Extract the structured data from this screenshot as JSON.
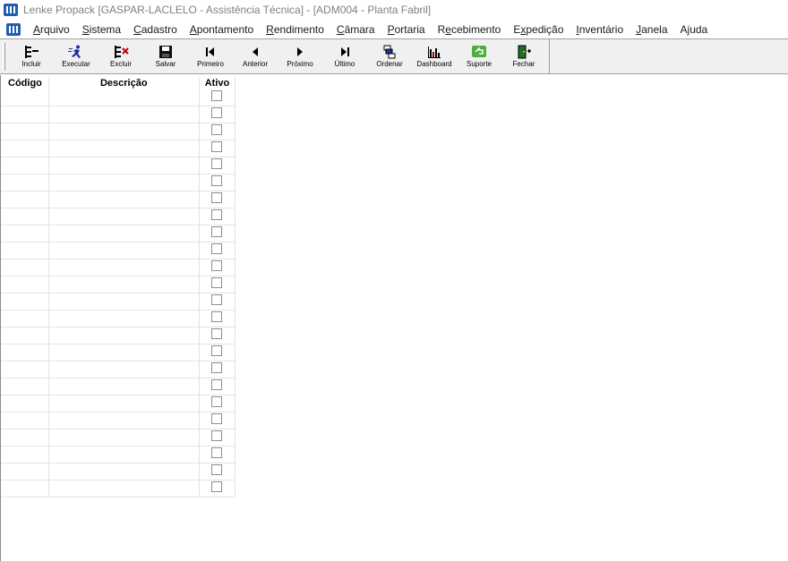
{
  "window": {
    "title": "Lenke Propack [GASPAR-LACLELO - Assistência Técnica] - [ADM004 - Planta Fabril]",
    "app_icon": "app-logo-icon"
  },
  "menu": {
    "items": [
      {
        "label": "Arquivo",
        "accel": "A"
      },
      {
        "label": "Sistema",
        "accel": "S"
      },
      {
        "label": "Cadastro",
        "accel": "C"
      },
      {
        "label": "Apontamento",
        "accel": "A"
      },
      {
        "label": "Rendimento",
        "accel": "R"
      },
      {
        "label": "Câmara",
        "accel": "C"
      },
      {
        "label": "Portaria",
        "accel": "P"
      },
      {
        "label": "Recebimento",
        "accel": "e"
      },
      {
        "label": "Expedição",
        "accel": "x"
      },
      {
        "label": "Inventário",
        "accel": "I"
      },
      {
        "label": "Janela",
        "accel": "J"
      },
      {
        "label": "Ajuda",
        "accel": "j"
      }
    ]
  },
  "toolbar": {
    "buttons": [
      {
        "label": "Incluir",
        "icon": "add-record-icon"
      },
      {
        "label": "Executar",
        "icon": "run-icon"
      },
      {
        "label": "Excluir",
        "icon": "delete-record-icon"
      },
      {
        "label": "Salvar",
        "icon": "save-icon"
      },
      {
        "label": "Primeiro",
        "icon": "first-icon"
      },
      {
        "label": "Anterior",
        "icon": "previous-icon"
      },
      {
        "label": "Próximo",
        "icon": "next-icon"
      },
      {
        "label": "Último",
        "icon": "last-icon"
      },
      {
        "label": "Ordenar",
        "icon": "sort-icon"
      },
      {
        "label": "Dashboard",
        "icon": "dashboard-icon"
      },
      {
        "label": "Suporte",
        "icon": "support-icon"
      },
      {
        "label": "Fechar",
        "icon": "close-door-icon"
      }
    ]
  },
  "grid": {
    "columns": [
      "Código",
      "Descrição",
      "Ativo"
    ],
    "rows": [
      {
        "codigo": "",
        "descricao": "",
        "ativo": false
      },
      {
        "codigo": "",
        "descricao": "",
        "ativo": false
      },
      {
        "codigo": "",
        "descricao": "",
        "ativo": false
      },
      {
        "codigo": "",
        "descricao": "",
        "ativo": false
      },
      {
        "codigo": "",
        "descricao": "",
        "ativo": false
      },
      {
        "codigo": "",
        "descricao": "",
        "ativo": false
      },
      {
        "codigo": "",
        "descricao": "",
        "ativo": false
      },
      {
        "codigo": "",
        "descricao": "",
        "ativo": false
      },
      {
        "codigo": "",
        "descricao": "",
        "ativo": false
      },
      {
        "codigo": "",
        "descricao": "",
        "ativo": false
      },
      {
        "codigo": "",
        "descricao": "",
        "ativo": false
      },
      {
        "codigo": "",
        "descricao": "",
        "ativo": false
      },
      {
        "codigo": "",
        "descricao": "",
        "ativo": false
      },
      {
        "codigo": "",
        "descricao": "",
        "ativo": false
      },
      {
        "codigo": "",
        "descricao": "",
        "ativo": false
      },
      {
        "codigo": "",
        "descricao": "",
        "ativo": false
      },
      {
        "codigo": "",
        "descricao": "",
        "ativo": false
      },
      {
        "codigo": "",
        "descricao": "",
        "ativo": false
      },
      {
        "codigo": "",
        "descricao": "",
        "ativo": false
      },
      {
        "codigo": "",
        "descricao": "",
        "ativo": false
      },
      {
        "codigo": "",
        "descricao": "",
        "ativo": false
      },
      {
        "codigo": "",
        "descricao": "",
        "ativo": false
      },
      {
        "codigo": "",
        "descricao": "",
        "ativo": false
      },
      {
        "codigo": "",
        "descricao": "",
        "ativo": false
      }
    ]
  }
}
